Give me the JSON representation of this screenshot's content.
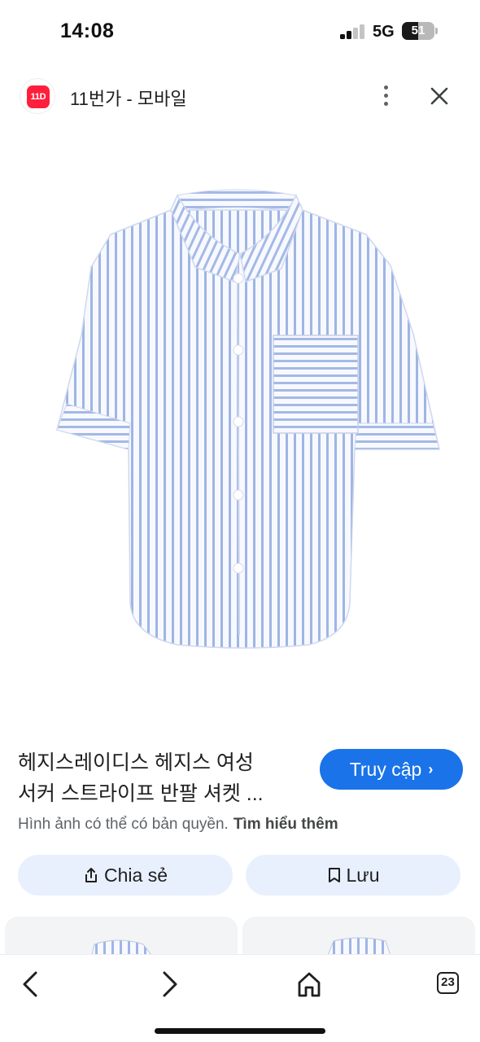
{
  "status": {
    "time": "14:08",
    "network": "5G",
    "battery": "51",
    "battery_level": 0.51
  },
  "header": {
    "logo_text": "11D",
    "title": "11번가 - 모바일",
    "more_icon": "more-vert-icon",
    "close_icon": "close-icon"
  },
  "product": {
    "image_icon": "striped-shirt-image",
    "title_line1": "헤지스레이디스 헤지스 여성",
    "title_line2": "서커 스트라이프 반팔 셔켓 ...",
    "visit_label": "Truy cập",
    "copyright_note": "Hình ảnh có thể có bản quyền.",
    "learn_more": "Tìm hiểu thêm"
  },
  "actions": {
    "share_label": "Chia sẻ",
    "save_label": "Lưu"
  },
  "bottom_nav": {
    "tab_count": "23"
  },
  "colors": {
    "accent": "#1a73e8",
    "pill_bg": "#e8f0fe",
    "shirt_stripe": "#8fa8de",
    "logo_red": "#ff1f3d"
  }
}
